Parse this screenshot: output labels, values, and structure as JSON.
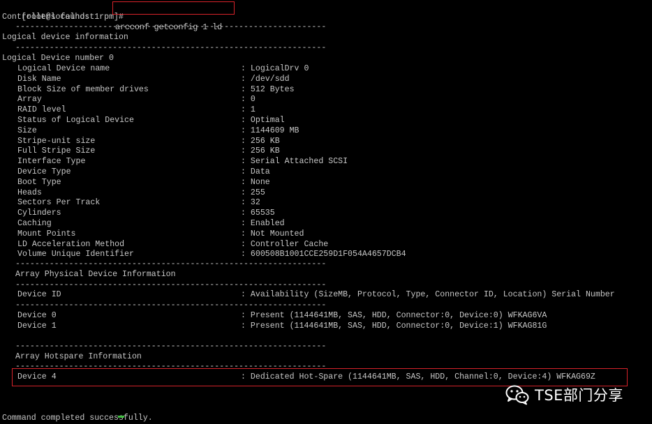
{
  "terminal": {
    "prompt": "[root@localhost rpm]#",
    "command": "arcconf getconfig 1 ld",
    "controllers_found": "Controllers found: 1",
    "divider": "----------------------------------------------------------------",
    "section_title": "Logical device information",
    "ld_number": "Logical Device number 0",
    "properties": [
      {
        "label": "Logical Device name",
        "value": ": LogicalDrv 0"
      },
      {
        "label": "Disk Name",
        "value": ": /dev/sdd"
      },
      {
        "label": "Block Size of member drives",
        "value": ": 512 Bytes"
      },
      {
        "label": "Array",
        "value": ": 0"
      },
      {
        "label": "RAID level",
        "value": ": 1"
      },
      {
        "label": "Status of Logical Device",
        "value": ": Optimal"
      },
      {
        "label": "Size",
        "value": ": 1144609 MB"
      },
      {
        "label": "Stripe-unit size",
        "value": ": 256 KB"
      },
      {
        "label": "Full Stripe Size",
        "value": ": 256 KB"
      },
      {
        "label": "Interface Type",
        "value": ": Serial Attached SCSI"
      },
      {
        "label": "Device Type",
        "value": ": Data"
      },
      {
        "label": "Boot Type",
        "value": ": None"
      },
      {
        "label": "Heads",
        "value": ": 255"
      },
      {
        "label": "Sectors Per Track",
        "value": ": 32"
      },
      {
        "label": "Cylinders",
        "value": ": 65535"
      },
      {
        "label": "Caching",
        "value": ": Enabled"
      },
      {
        "label": "Mount Points",
        "value": ": Not Mounted"
      },
      {
        "label": "LD Acceleration Method",
        "value": ": Controller Cache"
      },
      {
        "label": "Volume Unique Identifier",
        "value": ": 600508B1001CCE259D1F054A4657DCB4"
      }
    ],
    "physical_title": "Array Physical Device Information",
    "device_header": {
      "label": "Device ID",
      "value": ": Availability (SizeMB, Protocol, Type, Connector ID, Location) Serial Number"
    },
    "devices": [
      {
        "label": "Device 0",
        "value": ": Present (1144641MB, SAS, HDD, Connector:0, Device:0) WFKAG6VA"
      },
      {
        "label": "Device 1",
        "value": ": Present (1144641MB, SAS, HDD, Connector:0, Device:1) WFKAG81G"
      }
    ],
    "hotspare_title": "Array Hotspare Information",
    "hotspare": {
      "label": "Device 4",
      "value": ": Dedicated Hot-Spare (1144641MB, SAS, HDD, Channel:0, Device:4) WFKAG69Z"
    },
    "completed": "Command completed successfully."
  },
  "watermark": {
    "text": "TSE部门分享",
    "icon": "wechat-icon"
  },
  "colors": {
    "background": "#000000",
    "text": "#c8c8c8",
    "highlight": "#d8232a",
    "cursor": "#3fbf3f"
  }
}
